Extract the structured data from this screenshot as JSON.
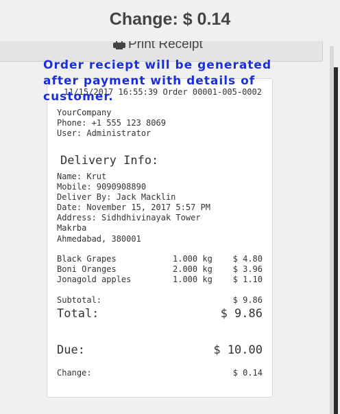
{
  "header": {
    "change_label": "Change: $ 0.14"
  },
  "print": {
    "label": "Print Receipt",
    "icon": "printer-icon"
  },
  "annotation": {
    "text": "Order reciept will be generated after payment with details of customer."
  },
  "receipt": {
    "order_line": "11/15/2017 16:55:39 Order 00001-005-0002",
    "company": "YourCompany",
    "phone": "Phone: +1 555 123 8069",
    "user": "User: Administrator",
    "delivery_title": "Delivery Info:",
    "name": "Name: Krut",
    "mobile": "Mobile: 9090908890",
    "deliver_by": "Deliver By: Jack Macklin",
    "date": "Date: November 15, 2017 5:57 PM",
    "address1": "Address: Sidhdhivinayak Tower",
    "address2": "Makrba",
    "address3": "Ahmedabad, 380001",
    "items": [
      {
        "name": "Black Grapes",
        "qty": "1.000 kg",
        "price": "$ 4.80"
      },
      {
        "name": "Boni Oranges",
        "qty": "2.000 kg",
        "price": "$ 3.96"
      },
      {
        "name": "Jonagold apples",
        "qty": "1.000 kg",
        "price": "$ 1.10"
      }
    ],
    "subtotal_label": "Subtotal:",
    "subtotal_value": "$ 9.86",
    "total_label": "Total:",
    "total_value": "$ 9.86",
    "due_label": "Due:",
    "due_value": "$ 10.00",
    "change_label": "Change:",
    "change_value": "$ 0.14"
  }
}
